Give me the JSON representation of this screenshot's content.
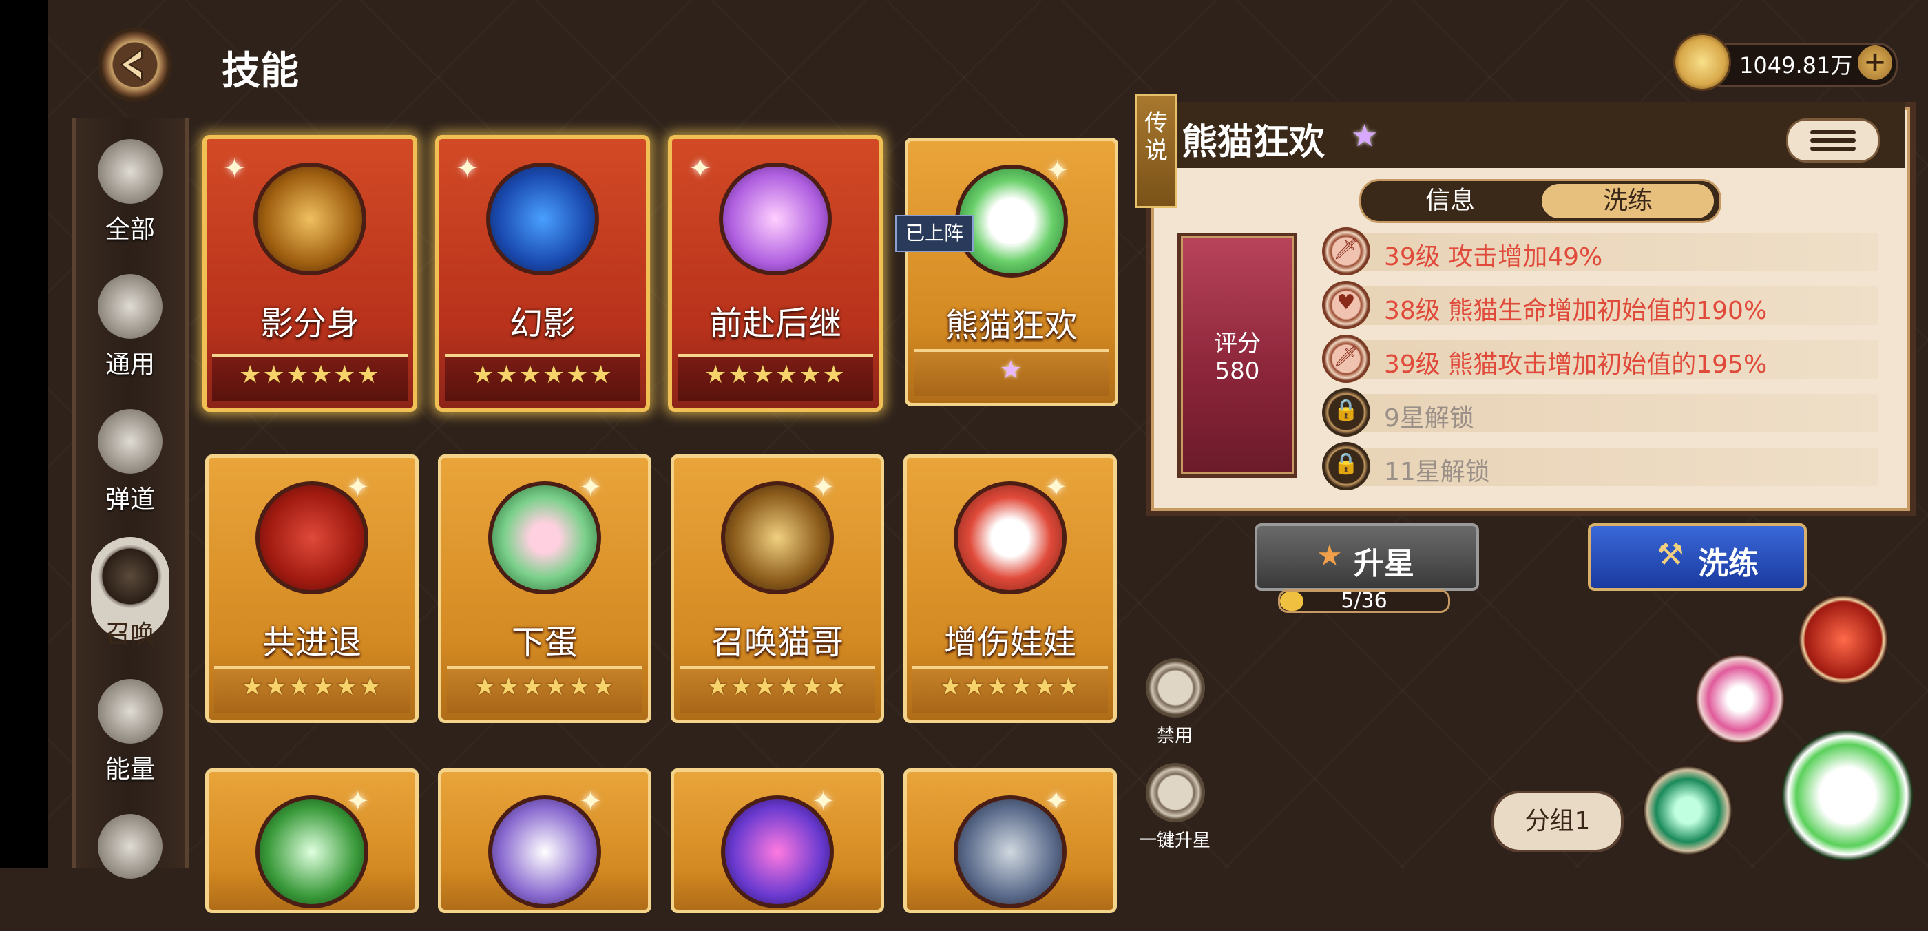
{
  "header": {
    "title": "技能"
  },
  "currency": {
    "value": "1049.81万",
    "plus": "+"
  },
  "sidebar": {
    "items": [
      {
        "label": "全部",
        "icon": "book-icon"
      },
      {
        "label": "通用",
        "icon": "tent-icon"
      },
      {
        "label": "弹道",
        "icon": "crosshair-icon"
      },
      {
        "label": "召唤",
        "icon": "summon-icon",
        "active": true
      },
      {
        "label": "能量",
        "icon": "energy-icon"
      }
    ]
  },
  "skills": [
    {
      "name": "影分身",
      "stars": "★★★★★★",
      "color": "red"
    },
    {
      "name": "幻影",
      "stars": "★★★★★★",
      "color": "red"
    },
    {
      "name": "前赴后继",
      "stars": "★★★★★★",
      "color": "red"
    },
    {
      "name": "熊猫狂欢",
      "stars": "★",
      "color": "gold"
    },
    {
      "name": "共进退",
      "stars": "★★★★★★",
      "color": "gold"
    },
    {
      "name": "下蛋",
      "stars": "★★★★★★",
      "color": "gold"
    },
    {
      "name": "召唤猫哥",
      "stars": "★★★★★★",
      "color": "gold"
    },
    {
      "name": "增伤娃娃",
      "stars": "★★★★★★",
      "color": "gold"
    }
  ],
  "deployed_tag": "已上阵",
  "detail": {
    "rarity": "传说",
    "name": "熊猫狂欢",
    "tabs": [
      "信息",
      "洗练"
    ],
    "active_tab": 1,
    "score_label": "评分",
    "score_value": "580",
    "attributes": [
      {
        "text": "39级 攻击增加49%",
        "locked": false
      },
      {
        "text": "38级 熊猫生命增加初始值的190%",
        "locked": false
      },
      {
        "text": "39级 熊猫攻击增加初始值的195%",
        "locked": false
      },
      {
        "text": "9星解锁",
        "locked": true
      },
      {
        "text": "11星解锁",
        "locked": true
      }
    ]
  },
  "actions": {
    "upstar_label": "升星",
    "progress_text": "5/36",
    "progress": 0.139,
    "refine_label": "洗练",
    "ban_label": "禁用",
    "one_click_label": "一键升星",
    "group_label": "分组1"
  }
}
